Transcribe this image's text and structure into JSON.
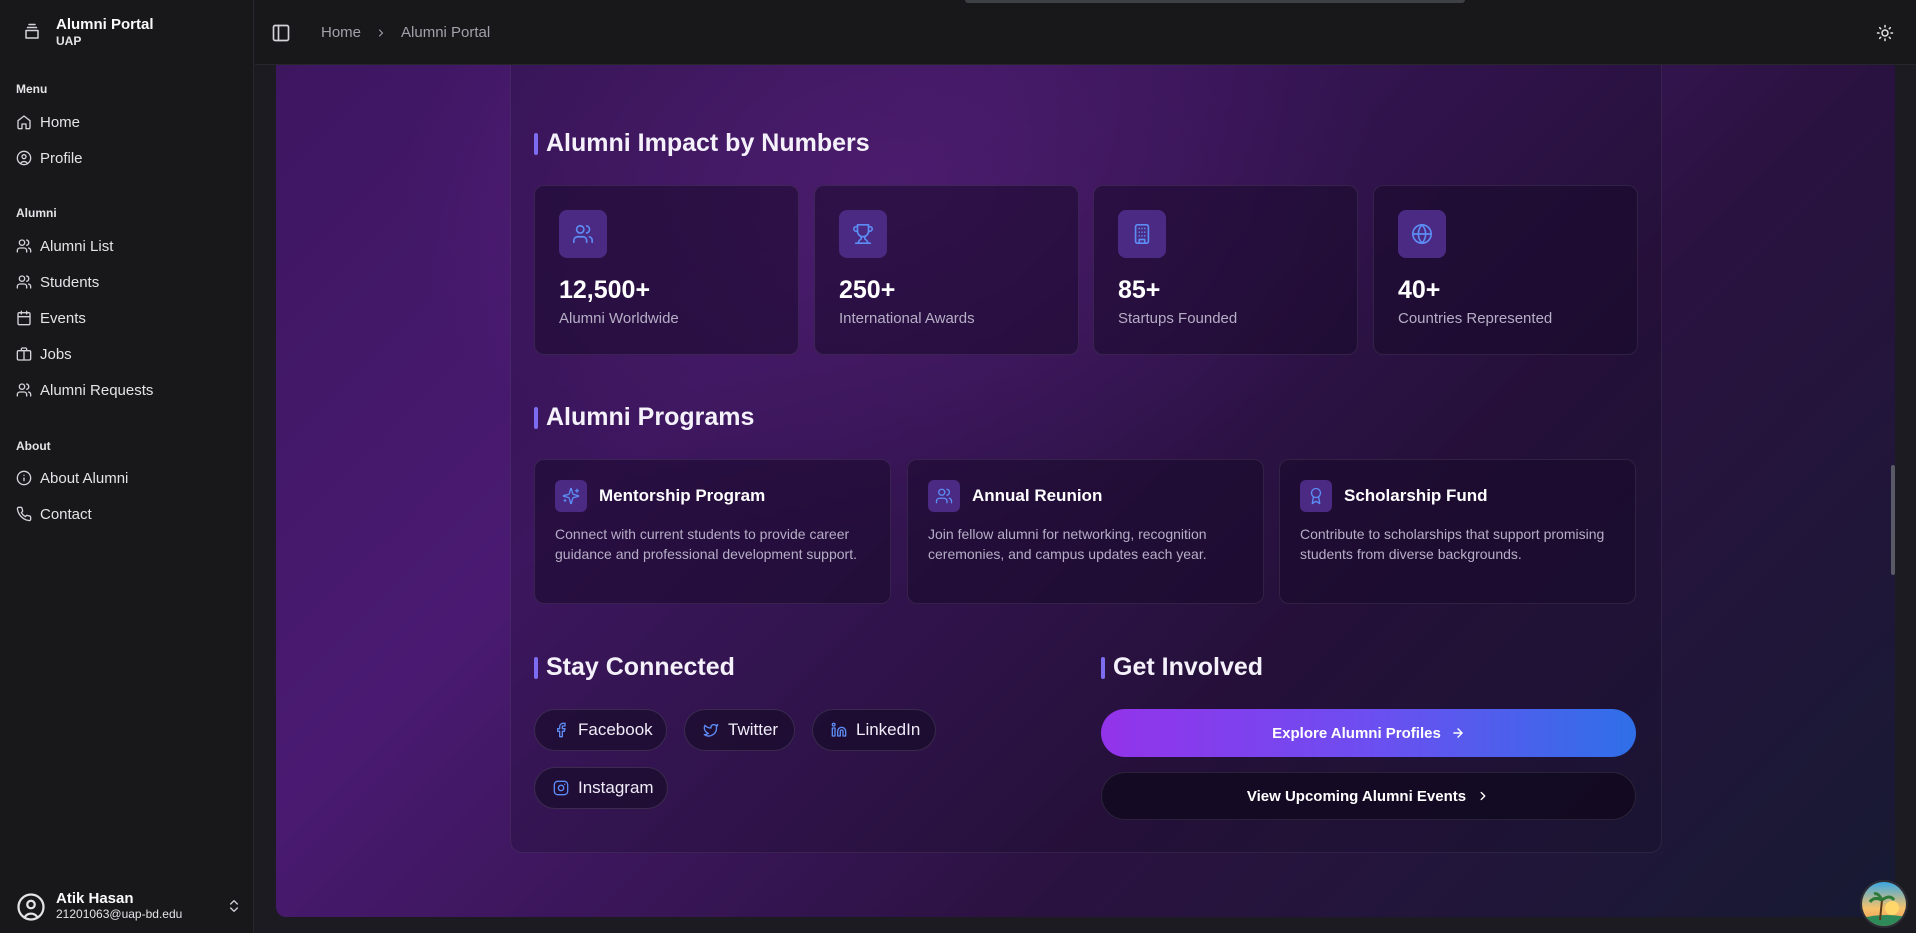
{
  "app": {
    "title": "Alumni Portal",
    "subtitle": "UAP"
  },
  "sidebar": {
    "groups": [
      {
        "label": "Menu",
        "items": [
          {
            "label": "Home",
            "icon": "home-icon"
          },
          {
            "label": "Profile",
            "icon": "user-circle-icon"
          }
        ]
      },
      {
        "label": "Alumni",
        "items": [
          {
            "label": "Alumni List",
            "icon": "users-icon"
          },
          {
            "label": "Students",
            "icon": "users-icon"
          },
          {
            "label": "Events",
            "icon": "calendar-icon"
          },
          {
            "label": "Jobs",
            "icon": "briefcase-icon"
          },
          {
            "label": "Alumni Requests",
            "icon": "users-icon"
          }
        ]
      },
      {
        "label": "About",
        "items": [
          {
            "label": "About Alumni",
            "icon": "info-icon"
          },
          {
            "label": "Contact",
            "icon": "phone-icon"
          }
        ]
      }
    ],
    "user": {
      "name": "Atik Hasan",
      "email": "21201063@uap-bd.edu"
    }
  },
  "header": {
    "breadcrumb": [
      "Home",
      "Alumni Portal"
    ]
  },
  "impact": {
    "title": "Alumni Impact by Numbers",
    "stats": [
      {
        "value": "12,500+",
        "label": "Alumni Worldwide",
        "icon": "users-icon"
      },
      {
        "value": "250+",
        "label": "International Awards",
        "icon": "trophy-icon"
      },
      {
        "value": "85+",
        "label": "Startups Founded",
        "icon": "building-icon"
      },
      {
        "value": "40+",
        "label": "Countries Represented",
        "icon": "globe-icon"
      }
    ]
  },
  "programs": {
    "title": "Alumni Programs",
    "items": [
      {
        "title": "Mentorship Program",
        "desc": "Connect with current students to provide career guidance and professional development support.",
        "icon": "sparkles-icon"
      },
      {
        "title": "Annual Reunion",
        "desc": "Join fellow alumni for networking, recognition ceremonies, and campus updates each year.",
        "icon": "users-icon"
      },
      {
        "title": "Scholarship Fund",
        "desc": "Contribute to scholarships that support promising students from diverse backgrounds.",
        "icon": "award-icon"
      }
    ]
  },
  "connect": {
    "title": "Stay Connected",
    "links": [
      {
        "label": "Facebook",
        "icon": "facebook-icon"
      },
      {
        "label": "Twitter",
        "icon": "twitter-icon"
      },
      {
        "label": "LinkedIn",
        "icon": "linkedin-icon"
      },
      {
        "label": "Instagram",
        "icon": "instagram-icon"
      }
    ]
  },
  "involved": {
    "title": "Get Involved",
    "primary_label": "Explore Alumni Profiles",
    "secondary_label": "View Upcoming Alumni Events"
  },
  "colors": {
    "accent_bar": "#7c6cf0",
    "icon_blue": "#5d8cf5",
    "icon_bg": "#4a2a82",
    "cta_start": "#9333ea",
    "cta_end": "#2f6fe8"
  }
}
